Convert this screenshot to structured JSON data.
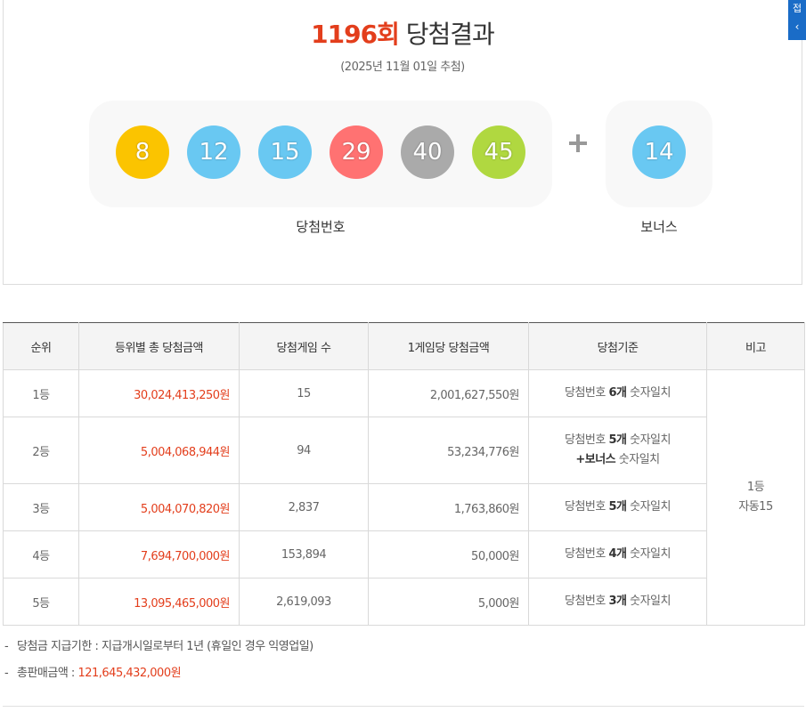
{
  "result": {
    "round": "1196회",
    "title_suffix": "당첨결과",
    "draw_date": "(2025년 11월 01일 추첨)",
    "numbers": [
      {
        "value": "8",
        "color": "#fbc400"
      },
      {
        "value": "12",
        "color": "#69c8f2"
      },
      {
        "value": "15",
        "color": "#69c8f2"
      },
      {
        "value": "29",
        "color": "#ff7272"
      },
      {
        "value": "40",
        "color": "#aaaaaa"
      },
      {
        "value": "45",
        "color": "#b0d840"
      }
    ],
    "bonus": {
      "value": "14",
      "color": "#69c8f2"
    },
    "main_caption": "당첨번호",
    "bonus_caption": "보너스"
  },
  "side_tab": {
    "label": "접",
    "chevron": "‹"
  },
  "table": {
    "headers": [
      "순위",
      "등위별 총 당첨금액",
      "당첨게임 수",
      "1게임당 당첨금액",
      "당첨기준",
      "비고"
    ],
    "rows": [
      {
        "rank": "1등",
        "total": "30,024,413,250원",
        "games": "15",
        "per_game": "2,001,627,550원",
        "crit_a": "당첨번호 ",
        "crit_b": "6개",
        "crit_c": " 숫자일치",
        "crit_d": "",
        "crit_e": ""
      },
      {
        "rank": "2등",
        "total": "5,004,068,944원",
        "games": "94",
        "per_game": "53,234,776원",
        "crit_a": "당첨번호 ",
        "crit_b": "5개",
        "crit_c": " 숫자일치",
        "crit_d": "+보너스",
        "crit_e": " 숫자일치"
      },
      {
        "rank": "3등",
        "total": "5,004,070,820원",
        "games": "2,837",
        "per_game": "1,763,860원",
        "crit_a": "당첨번호 ",
        "crit_b": "5개",
        "crit_c": " 숫자일치",
        "crit_d": "",
        "crit_e": ""
      },
      {
        "rank": "4등",
        "total": "7,694,700,000원",
        "games": "153,894",
        "per_game": "50,000원",
        "crit_a": "당첨번호 ",
        "crit_b": "4개",
        "crit_c": " 숫자일치",
        "crit_d": "",
        "crit_e": ""
      },
      {
        "rank": "5등",
        "total": "13,095,465,000원",
        "games": "2,619,093",
        "per_game": "5,000원",
        "crit_a": "당첨번호 ",
        "crit_b": "3개",
        "crit_c": " 숫자일치",
        "crit_d": "",
        "crit_e": ""
      }
    ],
    "note_line1": "1등",
    "note_line2": "자동15"
  },
  "notes": {
    "dash": "-",
    "deadline": "당첨금 지급기한 : 지급개시일로부터 1년 (휴일인 경우 익영업일)",
    "sales_label": "총판매금액 : ",
    "sales_value": "121,645,432,000원"
  }
}
